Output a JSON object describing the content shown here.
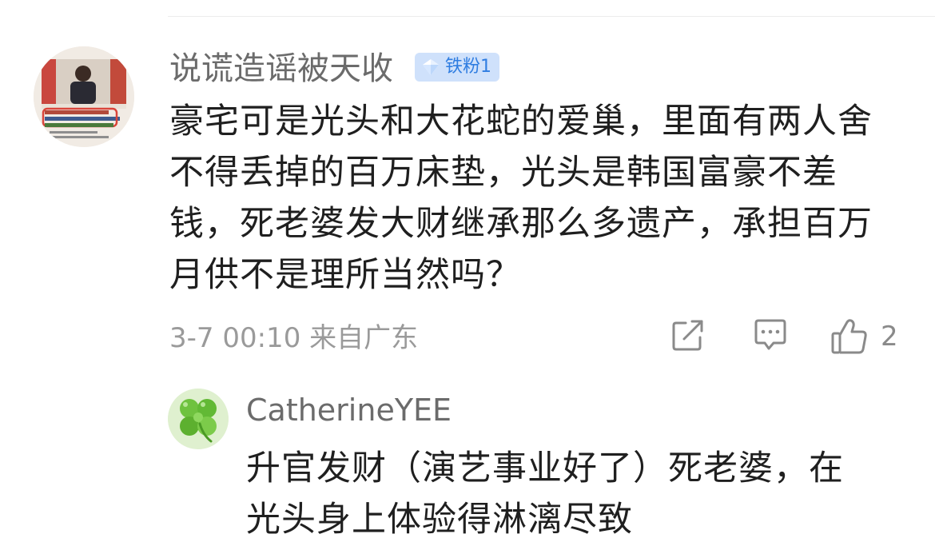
{
  "comment": {
    "author": "说谎造谣被天收",
    "badge": {
      "label": "铁粉1",
      "color": "#2f7de1",
      "icon": "diamond-icon"
    },
    "body_lines": [
      "豪宅可是光头和大花蛇的爱巢，里面有两人舍",
      "不得丢掉的百万床垫，光头是韩国富豪不差",
      "钱，死老婆发大财继承那么多遗产，承担百万",
      "月供不是理所当然吗？"
    ],
    "meta": "3-7 00:10 来自广东",
    "actions": {
      "share_icon": "share-icon",
      "reply_icon": "comment-icon",
      "like_icon": "thumbs-up-icon",
      "like_count": "2"
    }
  },
  "reply": {
    "author": "CatherineYEE",
    "body_lines": [
      "升官发财（演艺事业好了）死老婆，在",
      "光头身上体验得淋漓尽致"
    ]
  }
}
